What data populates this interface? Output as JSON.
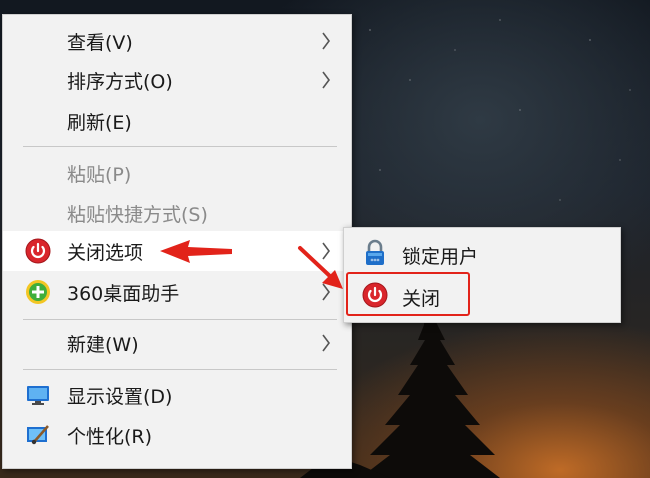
{
  "context_menu": {
    "items": [
      {
        "label": "查看(V)",
        "has_submenu": true,
        "enabled": true,
        "icon": null
      },
      {
        "label": "排序方式(O)",
        "has_submenu": true,
        "enabled": true,
        "icon": null
      },
      {
        "label": "刷新(E)",
        "has_submenu": false,
        "enabled": true,
        "icon": null
      },
      {
        "label": "粘贴(P)",
        "has_submenu": false,
        "enabled": false,
        "icon": null
      },
      {
        "label": "粘贴快捷方式(S)",
        "has_submenu": false,
        "enabled": false,
        "icon": null
      },
      {
        "label": "关闭选项",
        "has_submenu": true,
        "enabled": true,
        "icon": "power-icon",
        "highlighted": true
      },
      {
        "label": "360桌面助手",
        "has_submenu": true,
        "enabled": true,
        "icon": "360-plus-icon"
      },
      {
        "label": "新建(W)",
        "has_submenu": true,
        "enabled": true,
        "icon": null
      },
      {
        "label": "显示设置(D)",
        "has_submenu": false,
        "enabled": true,
        "icon": "monitor-icon"
      },
      {
        "label": "个性化(R)",
        "has_submenu": false,
        "enabled": true,
        "icon": "personalize-icon"
      }
    ]
  },
  "submenu": {
    "items": [
      {
        "label": "锁定用户",
        "icon": "lock-icon"
      },
      {
        "label": "关闭",
        "icon": "power-icon",
        "annotated": true
      }
    ]
  },
  "colors": {
    "menu_bg": "#f2f2f2",
    "hover_bg": "#ffffff",
    "annotation_red": "#e2231a",
    "power_red": "#d9262c"
  }
}
